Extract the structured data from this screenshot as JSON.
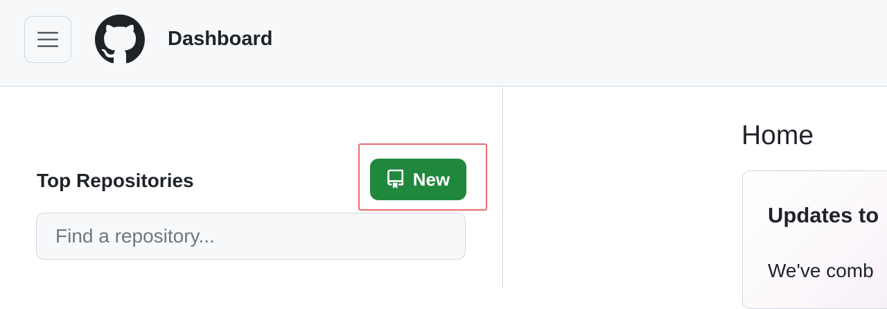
{
  "header": {
    "title": "Dashboard",
    "menu_icon": "hamburger-icon",
    "logo_icon": "github-logo-icon"
  },
  "sidebar": {
    "heading": "Top Repositories",
    "new_button_label": "New",
    "new_button_icon": "repo-icon",
    "search_placeholder": "Find a repository..."
  },
  "main": {
    "heading": "Home",
    "card": {
      "title": "Updates to",
      "text": "We've comb"
    }
  },
  "colors": {
    "header_bg": "#f6f8fa",
    "border": "#d0d7de",
    "primary_green": "#1f883d",
    "highlight_red": "#ea6a6a",
    "text": "#1f2328"
  }
}
